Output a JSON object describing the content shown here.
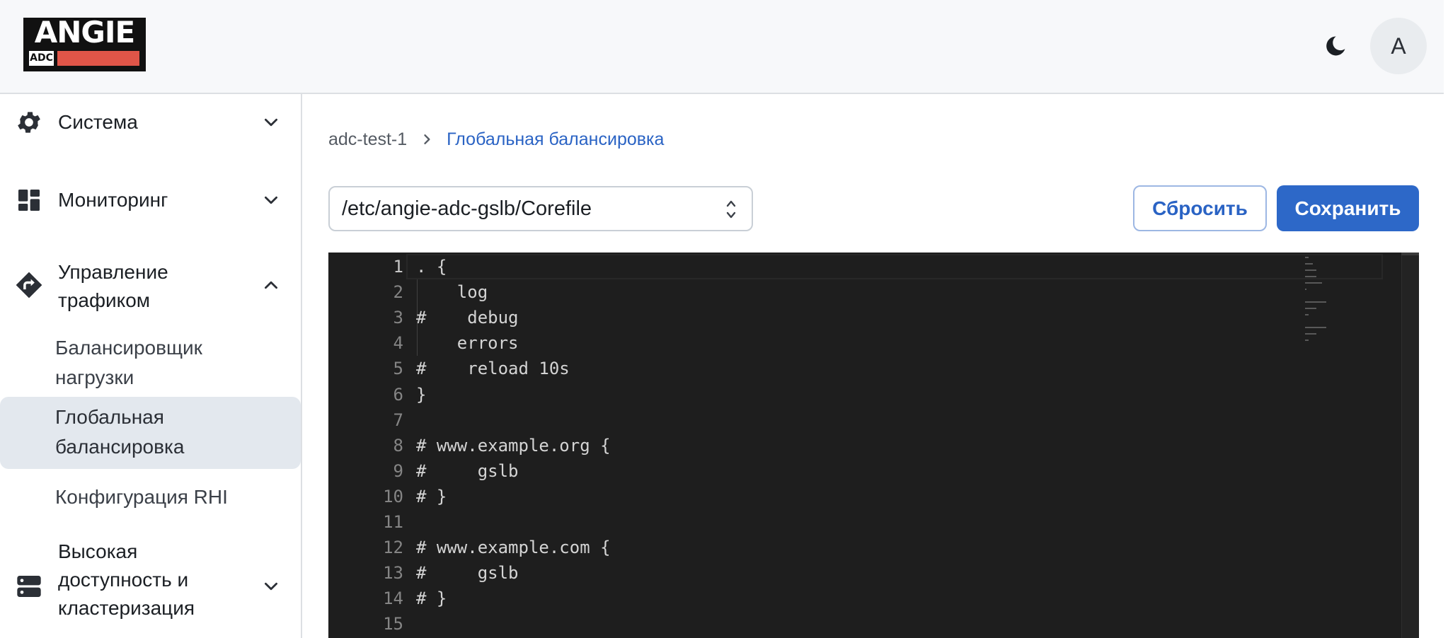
{
  "header": {
    "logo_text": "ANGIE",
    "logo_sub": "ADC",
    "avatar_letter": "A",
    "theme_icon": "moon-icon"
  },
  "sidebar": {
    "groups": [
      {
        "label": "Система",
        "icon": "gear-icon",
        "expanded": false
      },
      {
        "label": "Мониторинг",
        "icon": "dashboard-icon",
        "expanded": false
      },
      {
        "label": "Управление трафиком",
        "icon": "route-icon",
        "expanded": true,
        "items": [
          {
            "label": "Балансировщик нагрузки",
            "active": false
          },
          {
            "label": "Глобальная балансировка",
            "active": true
          },
          {
            "label": "Конфигурация RHI",
            "active": false
          }
        ]
      },
      {
        "label": "Высокая доступность и кластеризация",
        "icon": "server-icon",
        "expanded": false
      }
    ]
  },
  "breadcrumb": {
    "root": "adc-test-1",
    "current": "Глобальная балансировка"
  },
  "toolbar": {
    "file_select_value": "/etc/angie-adc-gslb/Corefile",
    "reset_label": "Сбросить",
    "save_label": "Сохранить"
  },
  "editor": {
    "lines": [
      {
        "n": "1",
        "code": ". {"
      },
      {
        "n": "2",
        "code": "    log"
      },
      {
        "n": "3",
        "code": "#    debug"
      },
      {
        "n": "4",
        "code": "    errors"
      },
      {
        "n": "5",
        "code": "#    reload 10s"
      },
      {
        "n": "6",
        "code": "}"
      },
      {
        "n": "7",
        "code": ""
      },
      {
        "n": "8",
        "code": "# www.example.org {"
      },
      {
        "n": "9",
        "code": "#     gslb"
      },
      {
        "n": "10",
        "code": "# }"
      },
      {
        "n": "11",
        "code": ""
      },
      {
        "n": "12",
        "code": "# www.example.com {"
      },
      {
        "n": "13",
        "code": "#     gslb"
      },
      {
        "n": "14",
        "code": "# }"
      },
      {
        "n": "15",
        "code": ""
      }
    ],
    "current_line": "1"
  },
  "colors": {
    "accent": "#2d68c8",
    "editor_bg": "#1e1e1e",
    "logo_red": "#e05548",
    "active_item_bg": "#e3e8ee"
  }
}
